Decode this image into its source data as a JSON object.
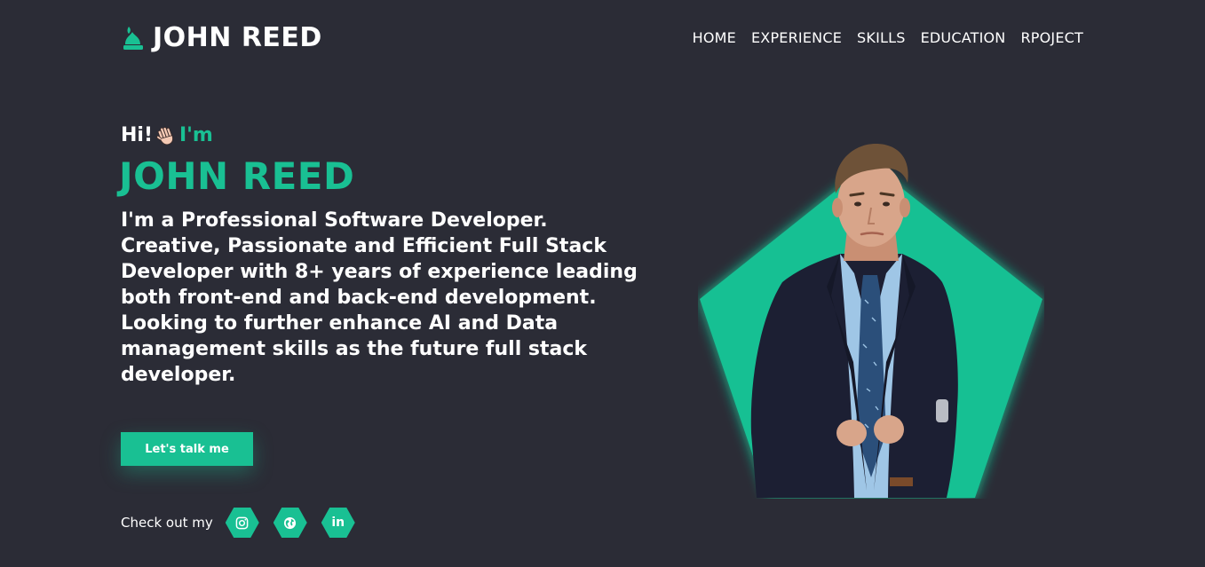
{
  "brand": {
    "name": "JOHN REED",
    "icon": "flame-logo-icon"
  },
  "nav": {
    "items": [
      {
        "label": "HOME"
      },
      {
        "label": "EXPERIENCE"
      },
      {
        "label": "SKILLS"
      },
      {
        "label": "EDUCATION"
      },
      {
        "label": "RPOJECT"
      }
    ]
  },
  "hero": {
    "hi": "Hi!",
    "wave": "👋🏻",
    "im": "I'm",
    "name": "JOHN REED",
    "description": "I'm a Professional Software Developer. Creative, Passionate and Efficient Full Stack Developer with 8+ years of experience leading both front-end and back-end development. Looking to further enhance AI and Data management skills as the future full stack developer.",
    "cta_label": "Let's talk me"
  },
  "social": {
    "label": "Check out my",
    "links": [
      {
        "icon": "instagram-icon"
      },
      {
        "icon": "globe-icon"
      },
      {
        "icon": "linkedin-icon",
        "text": "in"
      }
    ]
  },
  "colors": {
    "background": "#2b2c36",
    "accent": "#19c093",
    "text": "#ffffff",
    "suit": "#1c1f33",
    "shirt": "#9fc6e6",
    "tie": "#2b4f7a",
    "skin": "#d8a58a",
    "hair": "#6e5238"
  }
}
